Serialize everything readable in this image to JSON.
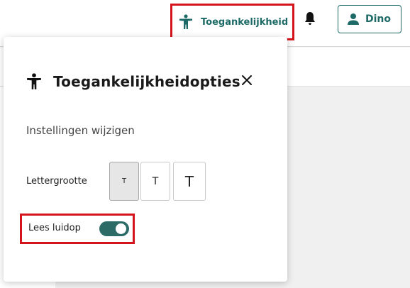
{
  "header": {
    "accessibility_label": "Toegankelijkheid",
    "user_label": "Dino",
    "accent_color": "#1d6a67"
  },
  "panel": {
    "title": "Toegankelijkheidopties",
    "subtitle": "Instellingen wijzigen",
    "font_size_label": "Lettergrootte",
    "font_size_options": [
      "T",
      "T",
      "T"
    ],
    "font_size_selected_index": 0,
    "read_aloud_label": "Lees luidop",
    "read_aloud_on": true,
    "toggle_color": "#2c6b66"
  },
  "icons": {
    "accessibility": "accessibility-person-icon",
    "notifications": "bell-icon",
    "user": "user-icon",
    "close": "close-icon"
  },
  "highlight_color": "#d4141c"
}
